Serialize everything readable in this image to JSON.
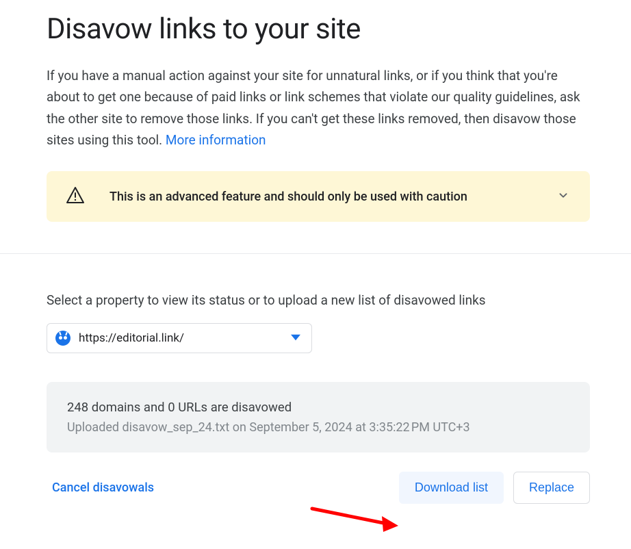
{
  "page": {
    "title": "Disavow links to your site",
    "intro": "If you have a manual action against your site for unnatural links, or if you think that you're about to get one because of paid links or link schemes that violate our quality guidelines, ask the other site to remove those links. If you can't get these links removed, then disavow those sites using this tool. ",
    "more_link": "More information"
  },
  "banner": {
    "text": "This is an advanced feature and should only be used with caution"
  },
  "select": {
    "label": "Select a property to view its status or to upload a new list of disavowed links",
    "selected_value": "https://editorial.link/"
  },
  "status": {
    "heading": "248 domains and 0 URLs are disavowed",
    "sub": "Uploaded disavow_sep_24.txt on September 5, 2024 at 3:35:22 PM UTC+3"
  },
  "actions": {
    "cancel": "Cancel disavowals",
    "download": "Download list",
    "replace": "Replace"
  }
}
